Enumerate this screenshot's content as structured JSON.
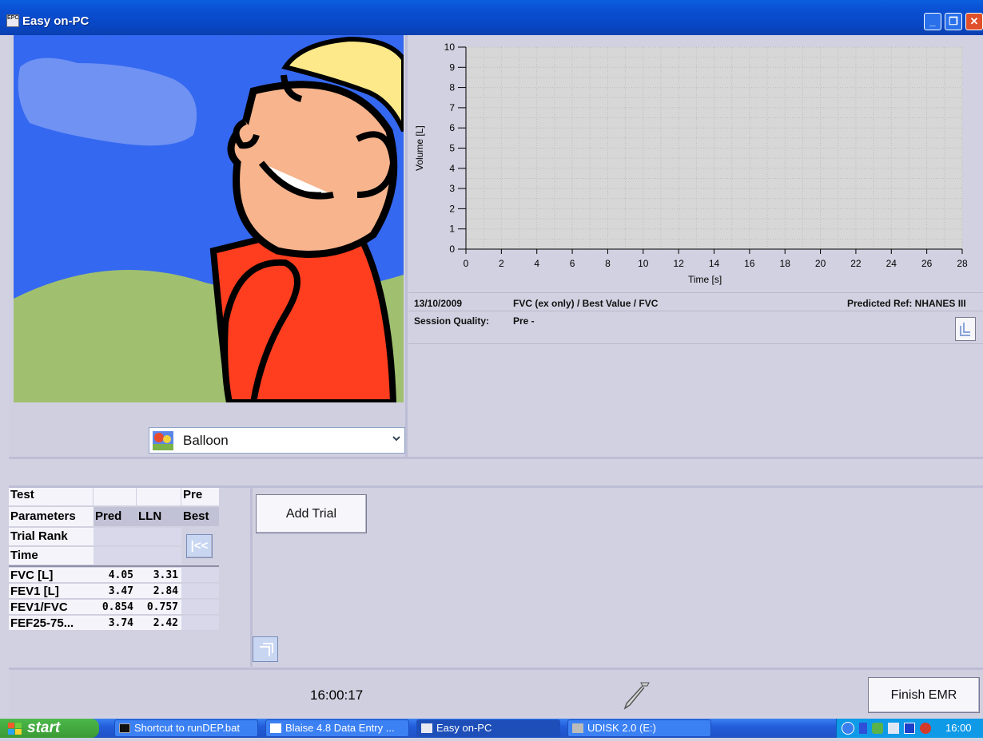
{
  "window": {
    "title": "Easy on-PC",
    "app_icon_text": "EPC"
  },
  "chart_data": {
    "type": "line",
    "title": "",
    "xlabel": "Time [s]",
    "ylabel": "Volume [L]",
    "xlim": [
      0,
      28
    ],
    "ylim": [
      0,
      10
    ],
    "x_ticks": [
      0,
      2,
      4,
      6,
      8,
      10,
      12,
      14,
      16,
      18,
      20,
      22,
      24,
      26,
      28
    ],
    "y_ticks": [
      0,
      1,
      2,
      3,
      4,
      5,
      6,
      7,
      8,
      9,
      10
    ],
    "grid": true,
    "series": []
  },
  "info": {
    "date": "13/10/2009",
    "test_desc": "FVC (ex only) / Best Value / FVC",
    "predicted_ref": "Predicted Ref: NHANES III",
    "session_quality_label": "Session Quality:",
    "session_quality_value": "Pre -"
  },
  "animation_select": {
    "selected": "Balloon"
  },
  "table": {
    "header1": {
      "c0": "Test",
      "c1": "",
      "c2": "",
      "c3": "Pre"
    },
    "header2": {
      "c0": "Parameters",
      "c1": "Pred",
      "c2": "LLN",
      "c3": "Best"
    },
    "trial_rank_label": "Trial Rank",
    "time_label": "Time",
    "rows": [
      {
        "param": "FVC [L]",
        "pred": "4.05",
        "lln": "3.31",
        "best": ""
      },
      {
        "param": "FEV1 [L]",
        "pred": "3.47",
        "lln": "2.84",
        "best": ""
      },
      {
        "param": "FEV1/FVC",
        "pred": "0.854",
        "lln": "0.757",
        "best": ""
      },
      {
        "param": "FEF25-75...",
        "pred": "3.74",
        "lln": "2.42",
        "best": ""
      }
    ],
    "first_trial_glyph": "|<<"
  },
  "buttons": {
    "add_trial": "Add Trial",
    "finish_emr": "Finish EMR"
  },
  "status": {
    "clock": "16:00:17"
  },
  "taskbar": {
    "start": "start",
    "tasks": [
      "Shortcut to runDEP.bat",
      "Blaise 4.8 Data Entry ...",
      "Easy on-PC",
      "UDISK 2.0 (E:)"
    ],
    "tray_time": "16:00"
  },
  "colors": {
    "titlebar": "#0a4fd2",
    "sky": "#3568f0",
    "grass": "#a0c070",
    "shirt": "#ff3d1f",
    "skin": "#f7b48d",
    "hair": "#fde98a",
    "chart_bg": "#d7d7d7"
  }
}
